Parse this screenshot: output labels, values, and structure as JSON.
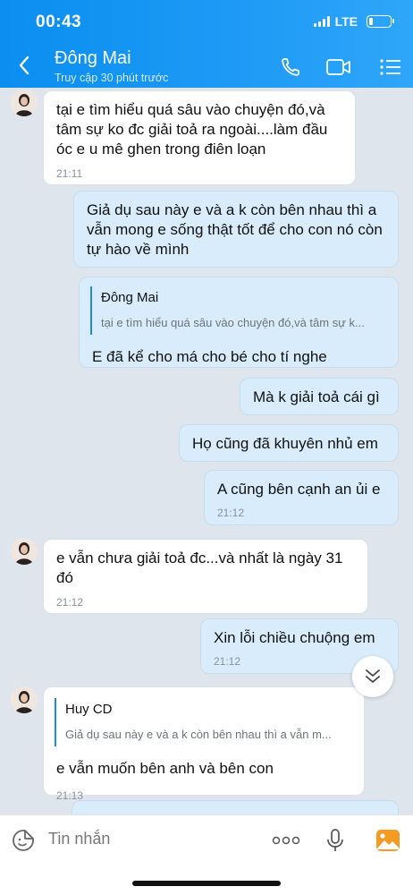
{
  "status_bar": {
    "time": "00:43",
    "network": "LTE"
  },
  "header": {
    "contact_name": "Đông Mai",
    "contact_status": "Truy cập 30 phút trước",
    "icons": [
      "back-arrow-icon",
      "phone-icon",
      "video-camera-icon",
      "menu-list-icon"
    ]
  },
  "messages": [
    {
      "side": "in",
      "text": "tại e tìm hiểu quá sâu vào chuyện đó,và tâm sự ko đc giải toả ra ngoài....làm đầu óc e u mê ghen trong điên loạn",
      "time": "21:11"
    },
    {
      "side": "out",
      "text": "Giả dụ sau này e và a k còn bên nhau thì a vẫn mong e sống thật tốt để cho con nó còn tự hào về mình"
    },
    {
      "side": "out",
      "quote_name": "Đông Mai",
      "quote_text": "tại e tìm hiểu quá sâu vào chuyện đó,và tâm sự k...",
      "text": "E đã kể cho má cho bé cho tí nghe"
    },
    {
      "side": "out",
      "text": "Mà k giải toả cái gì"
    },
    {
      "side": "out",
      "text": "Họ cũng đã khuyên nhủ em"
    },
    {
      "side": "out",
      "text": "A cũng bên cạnh an ủi e",
      "time": "21:12"
    },
    {
      "side": "in",
      "text": "e vẫn chưa giải toả đc...và nhất là ngày 31 đó",
      "time": "21:12"
    },
    {
      "side": "out",
      "text": "Xin lỗi chiều chuộng em",
      "time": "21:12"
    },
    {
      "side": "in",
      "quote_name": "Huy CD",
      "quote_text": "Giả dụ sau này e và a k còn bên nhau thì a vẫn m...",
      "text": "e vẫn muốn bên anh và bên con",
      "time": "21:13"
    }
  ],
  "input": {
    "placeholder": "Tin nhắn"
  },
  "colors": {
    "header": "#1a95f3",
    "outgoing_bubble": "#d8ecfb",
    "incoming_bubble": "#ffffff",
    "chat_background": "#dfe5ed"
  }
}
